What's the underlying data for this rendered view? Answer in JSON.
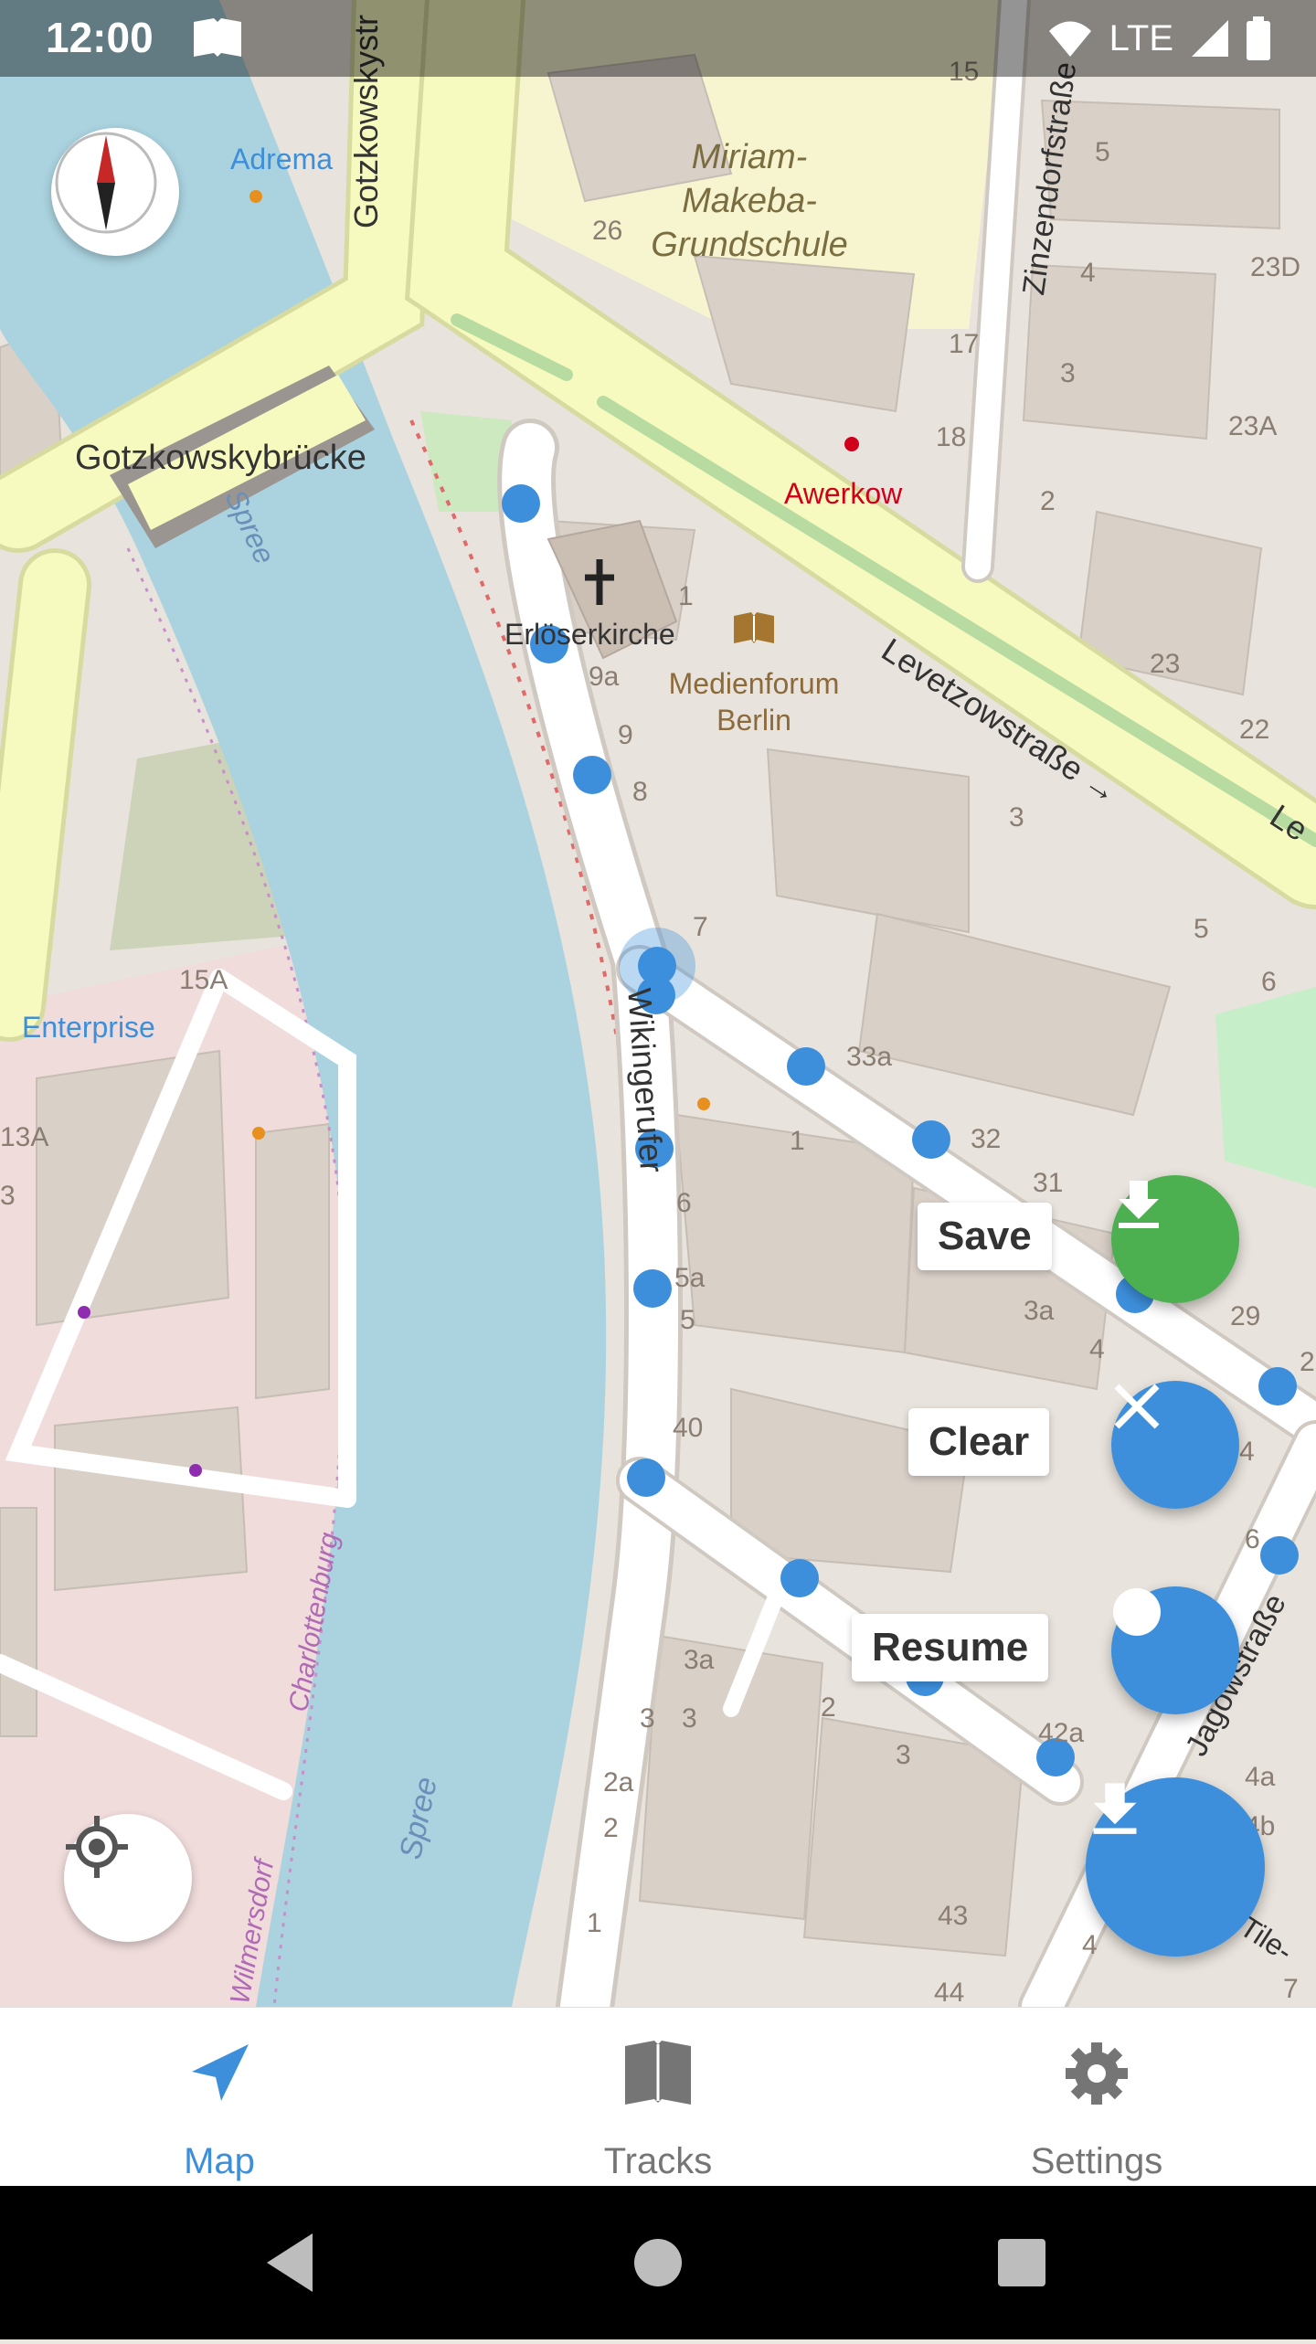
{
  "status_bar": {
    "time": "12:00",
    "network": "LTE"
  },
  "map": {
    "labels": {
      "school": [
        "Miriam-",
        "Makeba-",
        "Grundschule"
      ],
      "bridge": "Gotzkowskybrücke",
      "street_gotzkowsky": "Gotzkowskystr",
      "street_zinzendorf": "Zinzendorfstraße",
      "street_levetzow": "Levetzowstraße →",
      "street_wikinger": "Wikingerufer",
      "street_jagow": "Jagowstraße",
      "street_tile": "Tile-",
      "street_charlottenburg": "Charlottenburg",
      "street_wilmersdorf": "Wilmersdorf",
      "river_1": "Spree",
      "river_2": "Spree",
      "church": "Erlöserkirche",
      "poi_medienforum": [
        "Medienforum",
        "Berlin"
      ],
      "poi_awerkow": "Awerkow",
      "poi_adrema": "Adrema",
      "poi_enterprise": "Enterprise",
      "street_le": "Le"
    },
    "house_numbers": [
      "15",
      "5",
      "4",
      "23D",
      "26",
      "17",
      "3",
      "23A",
      "18",
      "2",
      "1",
      "23",
      "22",
      "9a",
      "9",
      "8",
      "3",
      "7",
      "5",
      "6",
      "15A",
      "13A",
      "3",
      "33a",
      "32",
      "31",
      "1",
      "6",
      "5a",
      "5",
      "3a",
      "4",
      "29",
      "2",
      "4",
      "6",
      "40",
      "3a",
      "3",
      "3",
      "2",
      "3",
      "2a",
      "2",
      "42a",
      "4a",
      "4b",
      "1",
      "43",
      "4",
      "44",
      "7"
    ]
  },
  "colors": {
    "accent": "#3d8fdc",
    "save_green": "#4caf50",
    "track_point": "#3d8fdc",
    "nav_inactive": "#757575"
  },
  "fab_menu": {
    "save_label": "Save",
    "clear_label": "Clear",
    "resume_label": "Resume"
  },
  "bottom_nav": {
    "map": "Map",
    "tracks": "Tracks",
    "settings": "Settings",
    "active": "Map"
  }
}
